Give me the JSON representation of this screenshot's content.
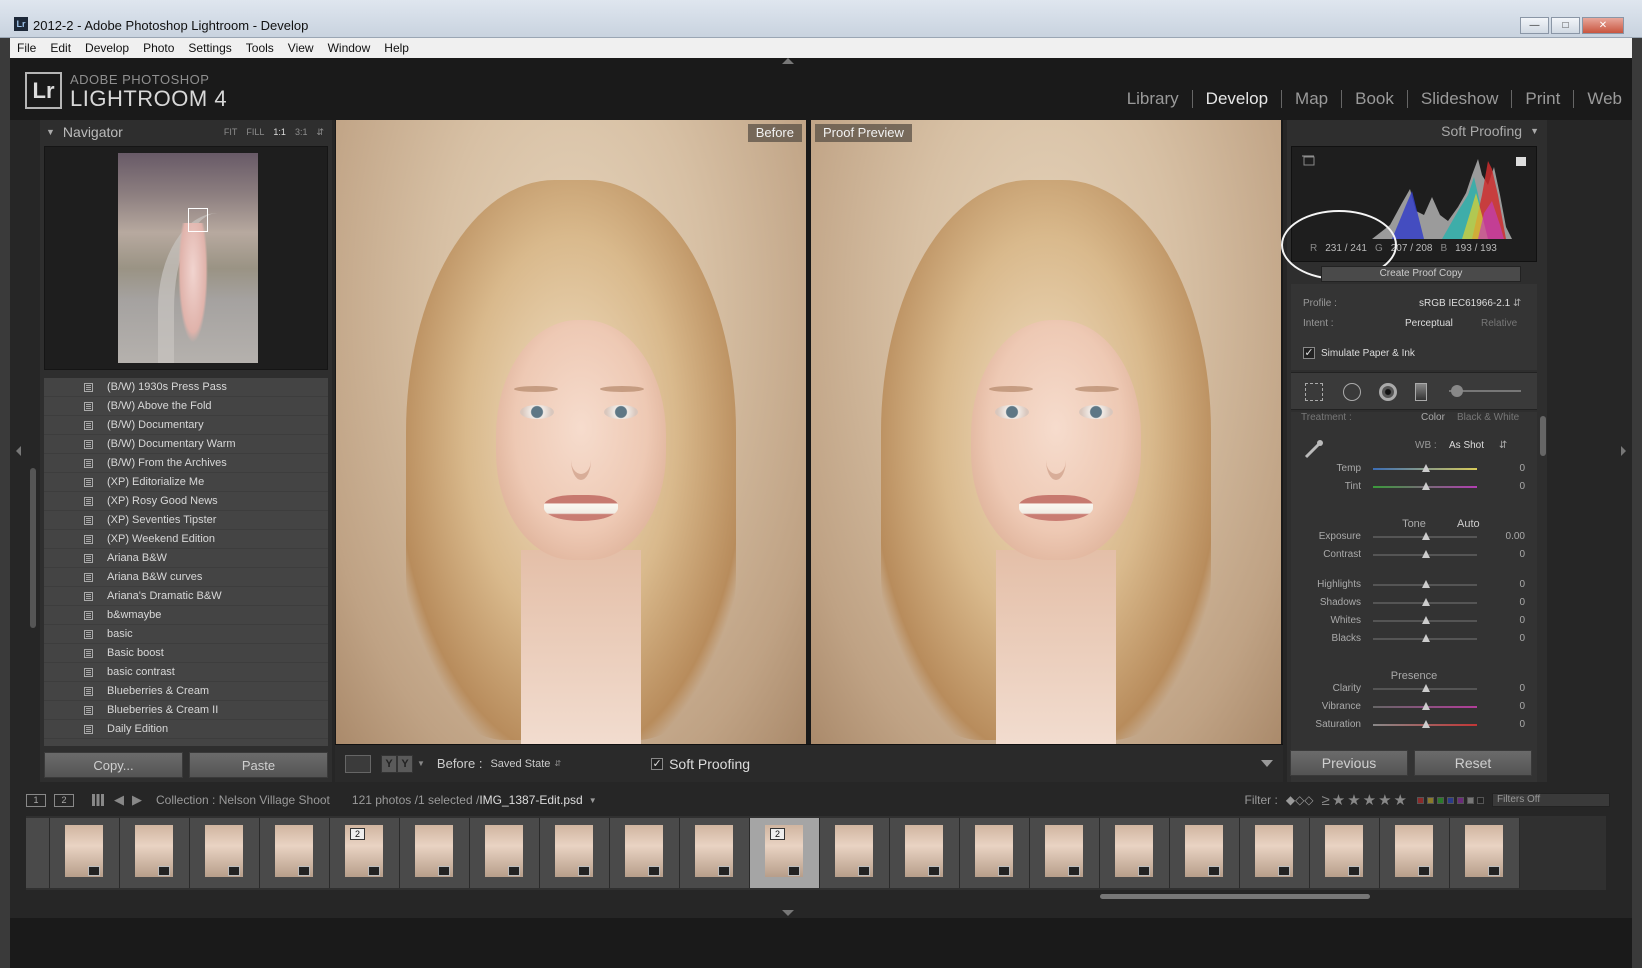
{
  "window": {
    "title": "2012-2 - Adobe Photoshop Lightroom - Develop",
    "app_icon": "Lr"
  },
  "menu": [
    "File",
    "Edit",
    "Develop",
    "Photo",
    "Settings",
    "Tools",
    "View",
    "Window",
    "Help"
  ],
  "brand": {
    "logo": "Lr",
    "line1": "ADOBE PHOTOSHOP",
    "line2": "LIGHTROOM 4"
  },
  "modules": [
    {
      "label": "Library",
      "active": false
    },
    {
      "label": "Develop",
      "active": true
    },
    {
      "label": "Map",
      "active": false
    },
    {
      "label": "Book",
      "active": false
    },
    {
      "label": "Slideshow",
      "active": false
    },
    {
      "label": "Print",
      "active": false
    },
    {
      "label": "Web",
      "active": false
    }
  ],
  "navigator": {
    "title": "Navigator",
    "zoom": [
      "FIT",
      "FILL",
      "1:1",
      "3:1"
    ],
    "zoom_active": "1:1"
  },
  "presets": [
    "(B/W) 1930s Press Pass",
    "(B/W) Above the Fold",
    "(B/W) Documentary",
    "(B/W) Documentary Warm",
    "(B/W) From the Archives",
    "(XP) Editorialize Me",
    "(XP) Rosy Good News",
    "(XP) Seventies Tipster",
    "(XP) Weekend Edition",
    "Ariana B&W",
    "Ariana B&W curves",
    "Ariana's Dramatic B&W",
    "b&wmaybe",
    "basic",
    "Basic boost",
    "basic contrast",
    "Blueberries & Cream",
    "Blueberries & Cream II",
    "Daily Edition"
  ],
  "left_buttons": {
    "copy": "Copy...",
    "paste": "Paste"
  },
  "center": {
    "before_label": "Before",
    "after_label": "Proof Preview"
  },
  "toolbar": {
    "yy": "Y|Y",
    "before": "Before :",
    "state": "Saved State",
    "soft_proofing": "Soft Proofing",
    "soft_proofing_checked": true
  },
  "soft_proofing_panel": {
    "title": "Soft Proofing",
    "rgb": {
      "r_label": "R",
      "r": "231 / 241",
      "g_label": "G",
      "g": "207 / 208",
      "b_label": "B",
      "b": "193 / 193"
    },
    "create_proof_copy": "Create Proof Copy",
    "profile_label": "Profile :",
    "profile_value": "sRGB IEC61966-2.1",
    "intent_label": "Intent :",
    "intent_perceptual": "Perceptual",
    "intent_relative": "Relative",
    "simulate_label": "Simulate Paper & Ink",
    "simulate_checked": true
  },
  "basic": {
    "treatment_label": "Treatment :",
    "treatment_color": "Color",
    "treatment_bw": "Black & White",
    "wb_label": "WB :",
    "wb_value": "As Shot",
    "tone_label": "Tone",
    "auto": "Auto",
    "presence_label": "Presence",
    "sliders": [
      {
        "label": "Temp",
        "value": "0"
      },
      {
        "label": "Tint",
        "value": "0"
      },
      {
        "label": "Exposure",
        "value": "0.00"
      },
      {
        "label": "Contrast",
        "value": "0"
      },
      {
        "label": "Highlights",
        "value": "0"
      },
      {
        "label": "Shadows",
        "value": "0"
      },
      {
        "label": "Whites",
        "value": "0"
      },
      {
        "label": "Blacks",
        "value": "0"
      },
      {
        "label": "Clarity",
        "value": "0"
      },
      {
        "label": "Vibrance",
        "value": "0"
      },
      {
        "label": "Saturation",
        "value": "0"
      }
    ]
  },
  "right_buttons": {
    "previous": "Previous",
    "reset": "Reset"
  },
  "filmstrip_bar": {
    "screen1": "1",
    "screen2": "2",
    "collection": "Collection : Nelson Village Shoot",
    "count": "121 photos /1 selected /",
    "filename": "IMG_1387-Edit.psd",
    "filter_label": "Filter :",
    "filters_off": "Filters Off"
  },
  "filmstrip": {
    "count": 21,
    "selected_index": 10,
    "badges": {
      "4": "2",
      "10": "2"
    }
  }
}
